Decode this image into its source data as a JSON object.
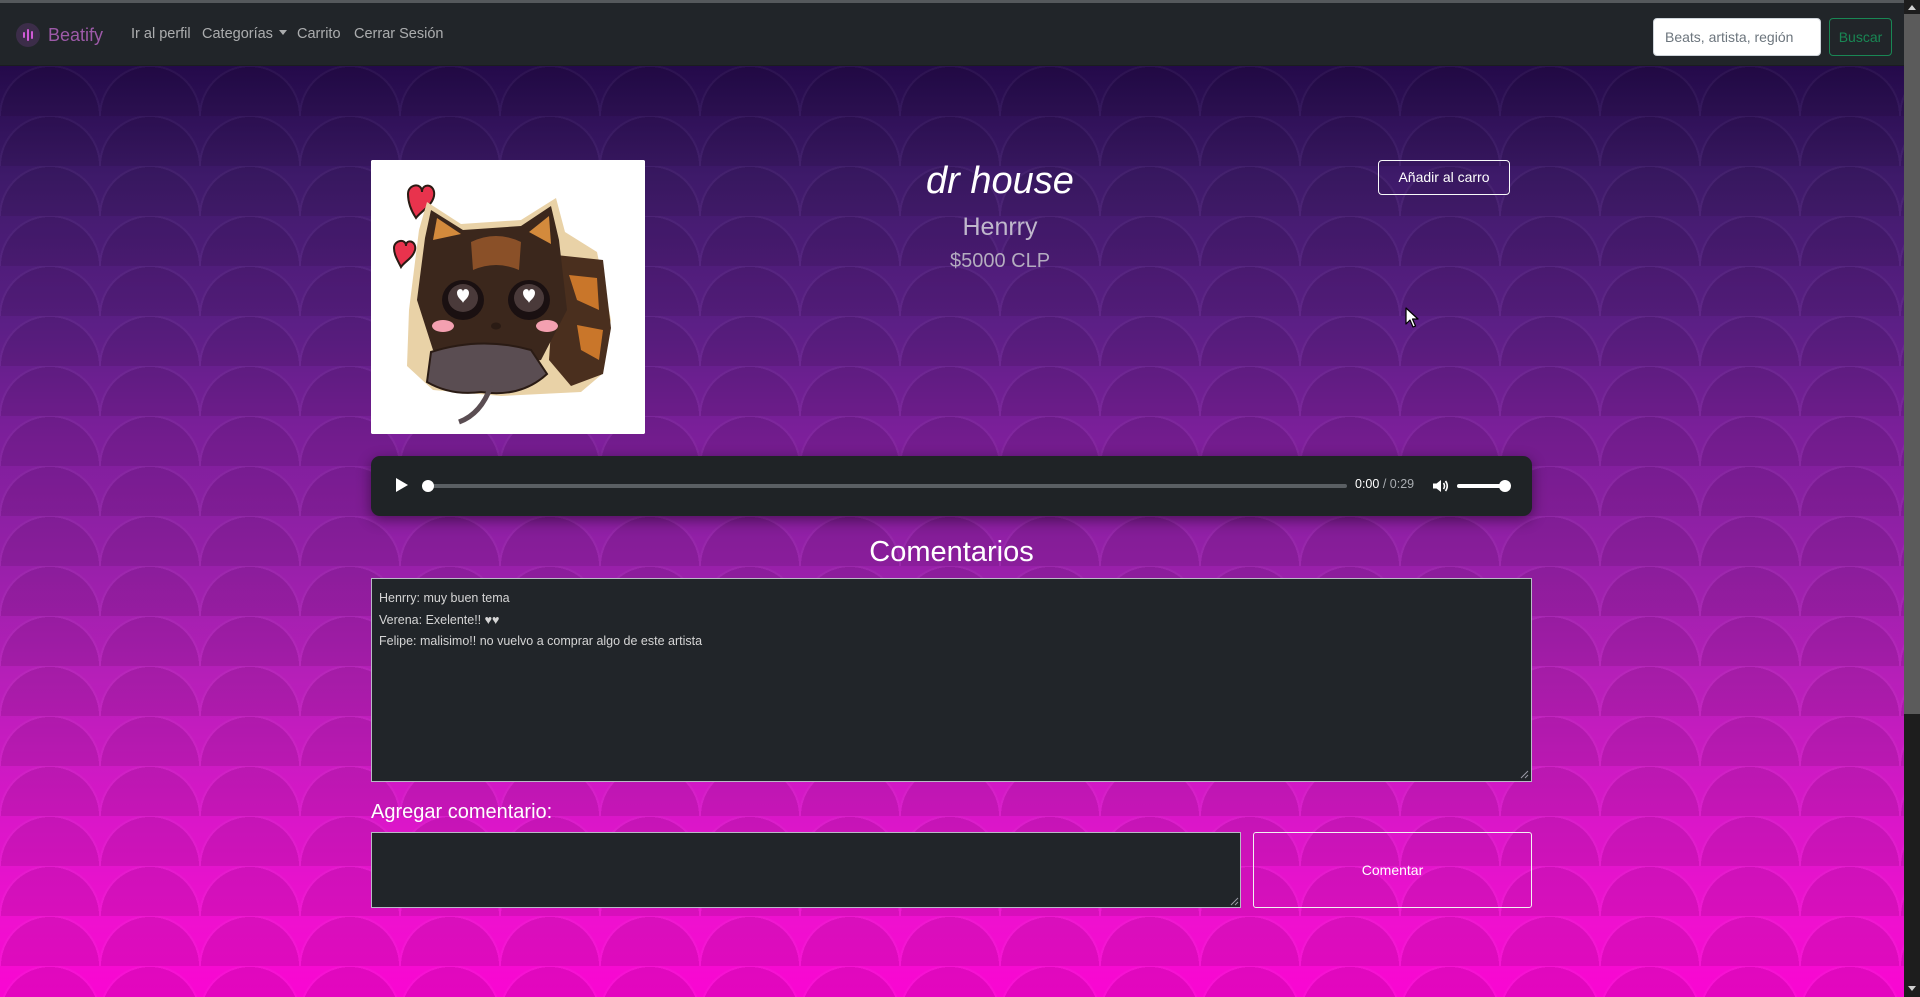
{
  "navbar": {
    "brand": "Beatify",
    "links": [
      "Ir al perfil",
      "Categorías",
      "Carrito",
      "Cerrar Sesión"
    ],
    "search_placeholder": "Beats, artista, región",
    "search_button": "Buscar"
  },
  "product": {
    "title": "dr house",
    "artist": "Henrry",
    "price": "$5000 CLP",
    "add_to_cart": "Añadir al carro",
    "cover_icon": "cat-sticker-image"
  },
  "player": {
    "current_time": "0:00",
    "separator": "/",
    "duration": "0:29",
    "progress": 0,
    "volume": 1
  },
  "comments": {
    "title": "Comentarios",
    "lines": [
      "Henrry: muy buen tema",
      "Verena: Exelente!! ♥♥",
      "Felipe: malisimo!! no vuelvo a comprar algo de este artista"
    ],
    "add_label": "Agregar comentario:",
    "input_value": "",
    "submit_label": "Comentar"
  },
  "colors": {
    "navbar": "#212529",
    "brand": "#9d5aa8",
    "search_button": "#198754",
    "gradient_top": "#240a4a",
    "gradient_bottom": "#fa06d2"
  }
}
